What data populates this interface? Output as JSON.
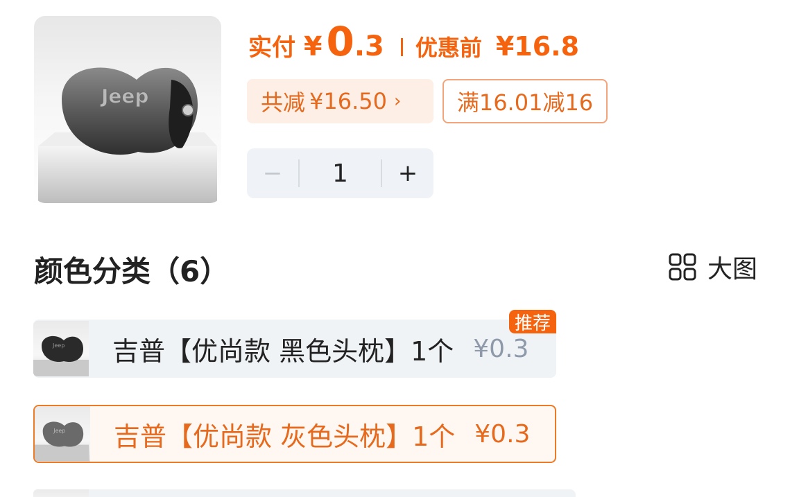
{
  "product": {
    "image_icon": "headrest-pillow-image",
    "brand_mark": "Jeep"
  },
  "price": {
    "paid_label": "实付",
    "currency": "¥",
    "paid_int": "0",
    "paid_dec": ".3",
    "original_label": "优惠前",
    "original_price": "¥16.8"
  },
  "discount": {
    "total_label": "共减",
    "total_value": "¥16.50",
    "coupon_text": "满16.01减16"
  },
  "quantity": {
    "minus": "−",
    "value": "1",
    "plus": "+"
  },
  "section": {
    "title": "颜色分类（6）",
    "view_toggle_label": "大图",
    "view_toggle_icon": "grid-icon"
  },
  "variants": [
    {
      "name": "吉普【优尚款 黑色头枕】1个",
      "price": "¥0.3",
      "tag": "推荐",
      "selected": false
    },
    {
      "name": "吉普【优尚款 灰色头枕】1个",
      "price": "¥0.3",
      "tag": "",
      "selected": true
    }
  ],
  "colors": {
    "accent": "#f5630e",
    "chip_bg": "#fdeee6",
    "selected_border": "#ec7a26",
    "muted_price": "#8e9aaa"
  }
}
